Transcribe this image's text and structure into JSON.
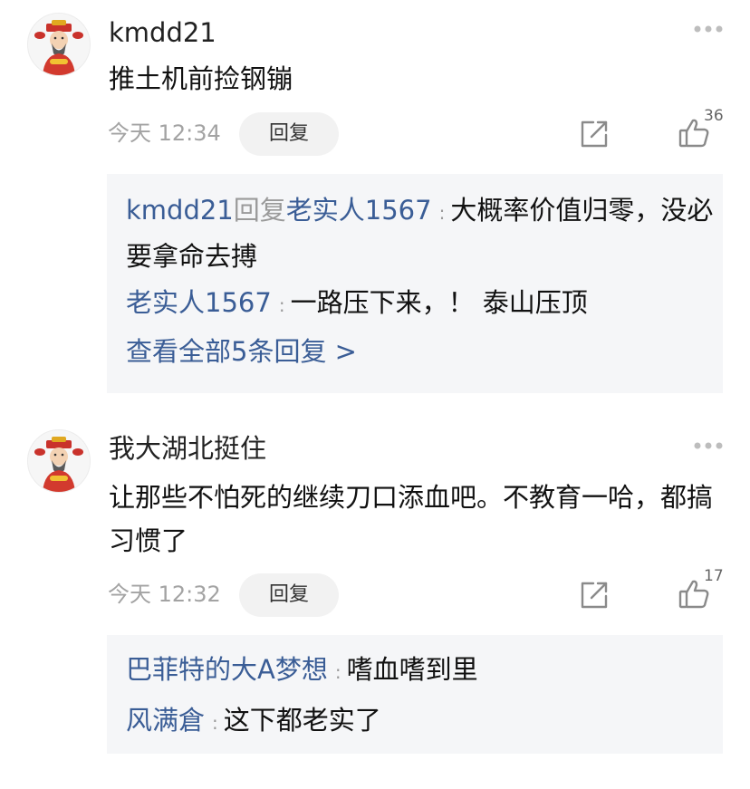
{
  "icons": {
    "avatar": "god-of-wealth-avatar",
    "more": "more-dots-icon",
    "share": "share-arrow-icon",
    "like": "thumbs-up-icon"
  },
  "colors": {
    "link_blue": "#3a5d96",
    "reply_bg": "#f5f6f8",
    "muted": "#a3a3a3"
  },
  "comments": [
    {
      "username": "kmdd21",
      "content": "推土机前捡钢镚",
      "time": "今天 12:34",
      "reply_label": "回复",
      "like_count": "36",
      "replies": [
        {
          "from": "kmdd21",
          "verb": "回复",
          "to": "老实人1567",
          "colon": ":",
          "text": "大概率价值归零，没必要拿命去搏"
        },
        {
          "from": "老实人1567",
          "colon": ":",
          "text": "一路压下来，！ 泰山压顶"
        }
      ],
      "view_all": "查看全部5条回复 >"
    },
    {
      "username": "我大湖北挺住",
      "content": "让那些不怕死的继续刀口添血吧。不教育一哈，都搞习惯了",
      "time": "今天 12:32",
      "reply_label": "回复",
      "like_count": "17",
      "replies": [
        {
          "from": "巴菲特的大A梦想",
          "colon": ":",
          "text": "嗜血嗜到里"
        },
        {
          "from": "风满倉",
          "colon": ":",
          "text": "这下都老实了"
        }
      ]
    }
  ]
}
